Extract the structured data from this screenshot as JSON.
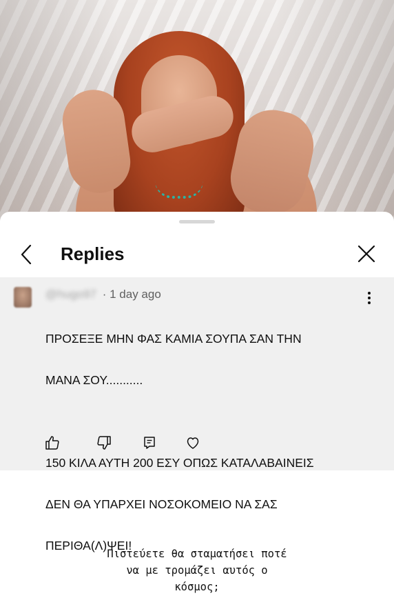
{
  "photo": {
    "icon": "photo"
  },
  "header": {
    "title": "Replies",
    "back_icon": "chevron-left-icon",
    "close_icon": "close-icon"
  },
  "comment": {
    "username": "@hugo97",
    "time": "· 1 day ago",
    "text_line1": "ΠΡΟΣΕΞΕ  ΜΗΝ ΦΑΣ  ΚΑΜΙΑ  ΣΟΥΠΑ  ΣΑΝ ΤΗΝ",
    "text_line2": "ΜΑΝΑ ΣΟΥ...........",
    "text_line3": "150 ΚΙΛΑ ΑΥΤΗ  200  ΕΣΥ  ΟΠΩΣ ΚΑΤΑΛΑΒΑΙΝΕΙΣ",
    "text_line4": "ΔΕΝ ΘΑ ΥΠΑΡΧΕΙ ΝΟΣΟΚΟΜΕΙΟ ΝΑ ΣΑΣ",
    "text_line5": "ΠΕΡΙΘΑ(Λ)ΨΕΙ!",
    "actions": [
      "like-icon",
      "dislike-icon",
      "reply-icon",
      "heart-icon"
    ]
  },
  "caption": {
    "line1": "Πιστεύετε θα σταματήσει ποτέ",
    "line2": "να με τρομάζει αυτός ο",
    "line3": "κόσμος;"
  }
}
